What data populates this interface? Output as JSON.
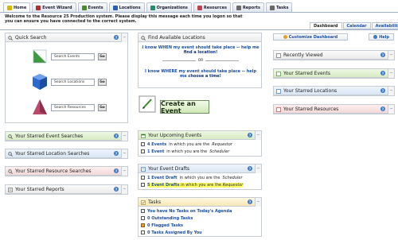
{
  "tabs": [
    {
      "label": "Home",
      "color": "#e0b500"
    },
    {
      "label": "Event Wizard",
      "color": "#b03030"
    },
    {
      "label": "Events",
      "color": "#4a8a2a"
    },
    {
      "label": "Locations",
      "color": "#2a5fb0"
    },
    {
      "label": "Organizations",
      "color": "#2a8a6a"
    },
    {
      "label": "Resources",
      "color": "#c04050"
    },
    {
      "label": "Reports",
      "color": "#6a6a6a"
    },
    {
      "label": "Tasks",
      "color": "#6a6a6a"
    }
  ],
  "welcome": "Welcome to the Resource 25 Production system. Please display this message each time you logon so that you can ensure you have connected to the correct system.",
  "view_tabs": [
    "Dashboard",
    "Calendar",
    "Availability"
  ],
  "help_symbol": "?",
  "min_symbol": "−",
  "quick_search": {
    "title": "Quick Search",
    "rows": [
      {
        "placeholder": "Search Events",
        "go": "Go",
        "icon": "events-icon"
      },
      {
        "placeholder": "Search Locations",
        "go": "Go",
        "icon": "locations-icon"
      },
      {
        "placeholder": "Search Resources",
        "go": "Go",
        "icon": "resources-icon"
      }
    ]
  },
  "find_locations": {
    "title": "Find Available Locations",
    "link1_a": "I know WHEN my event should take place -- help me ",
    "link1_b": "find a location!",
    "or": "OR",
    "link2_a": "I know WHERE my event should take place -- help me ",
    "link2_b": "choose a time!"
  },
  "create_event": {
    "label": "Create an Event"
  },
  "dashboard_controls": {
    "customize": "Customize Dashboard",
    "help": "Help"
  },
  "left_panels": [
    "Your Starred Event Searches",
    "Your Starred Location Searches",
    "Your Starred Resource Searches",
    "Your Starred Reports"
  ],
  "upcoming": {
    "title": "Your Upcoming Events",
    "rows": [
      {
        "count": "4 Events",
        "text": " in which you are the ",
        "role": "Requestor"
      },
      {
        "count": "1 Event",
        "text": " in which you are the ",
        "role": "Scheduler"
      }
    ]
  },
  "drafts": {
    "title": "Your Event Drafts",
    "rows": [
      {
        "count": "1 Event Draft",
        "text": " in which you are the ",
        "role": "Scheduler"
      },
      {
        "count": "5 Event Drafts",
        "text": " in which you are the ",
        "role": "Requestor"
      }
    ]
  },
  "tasks": {
    "title": "Tasks",
    "rows": [
      "You have No Tasks on Today's Agenda",
      "0 Outstanding Tasks",
      "0 Flagged Tasks",
      "0 Tasks Assigned By You"
    ]
  },
  "right_panels": [
    "Recently Viewed",
    "Your Starred Events",
    "Your Starred Locations",
    "Your Starred Resources"
  ]
}
